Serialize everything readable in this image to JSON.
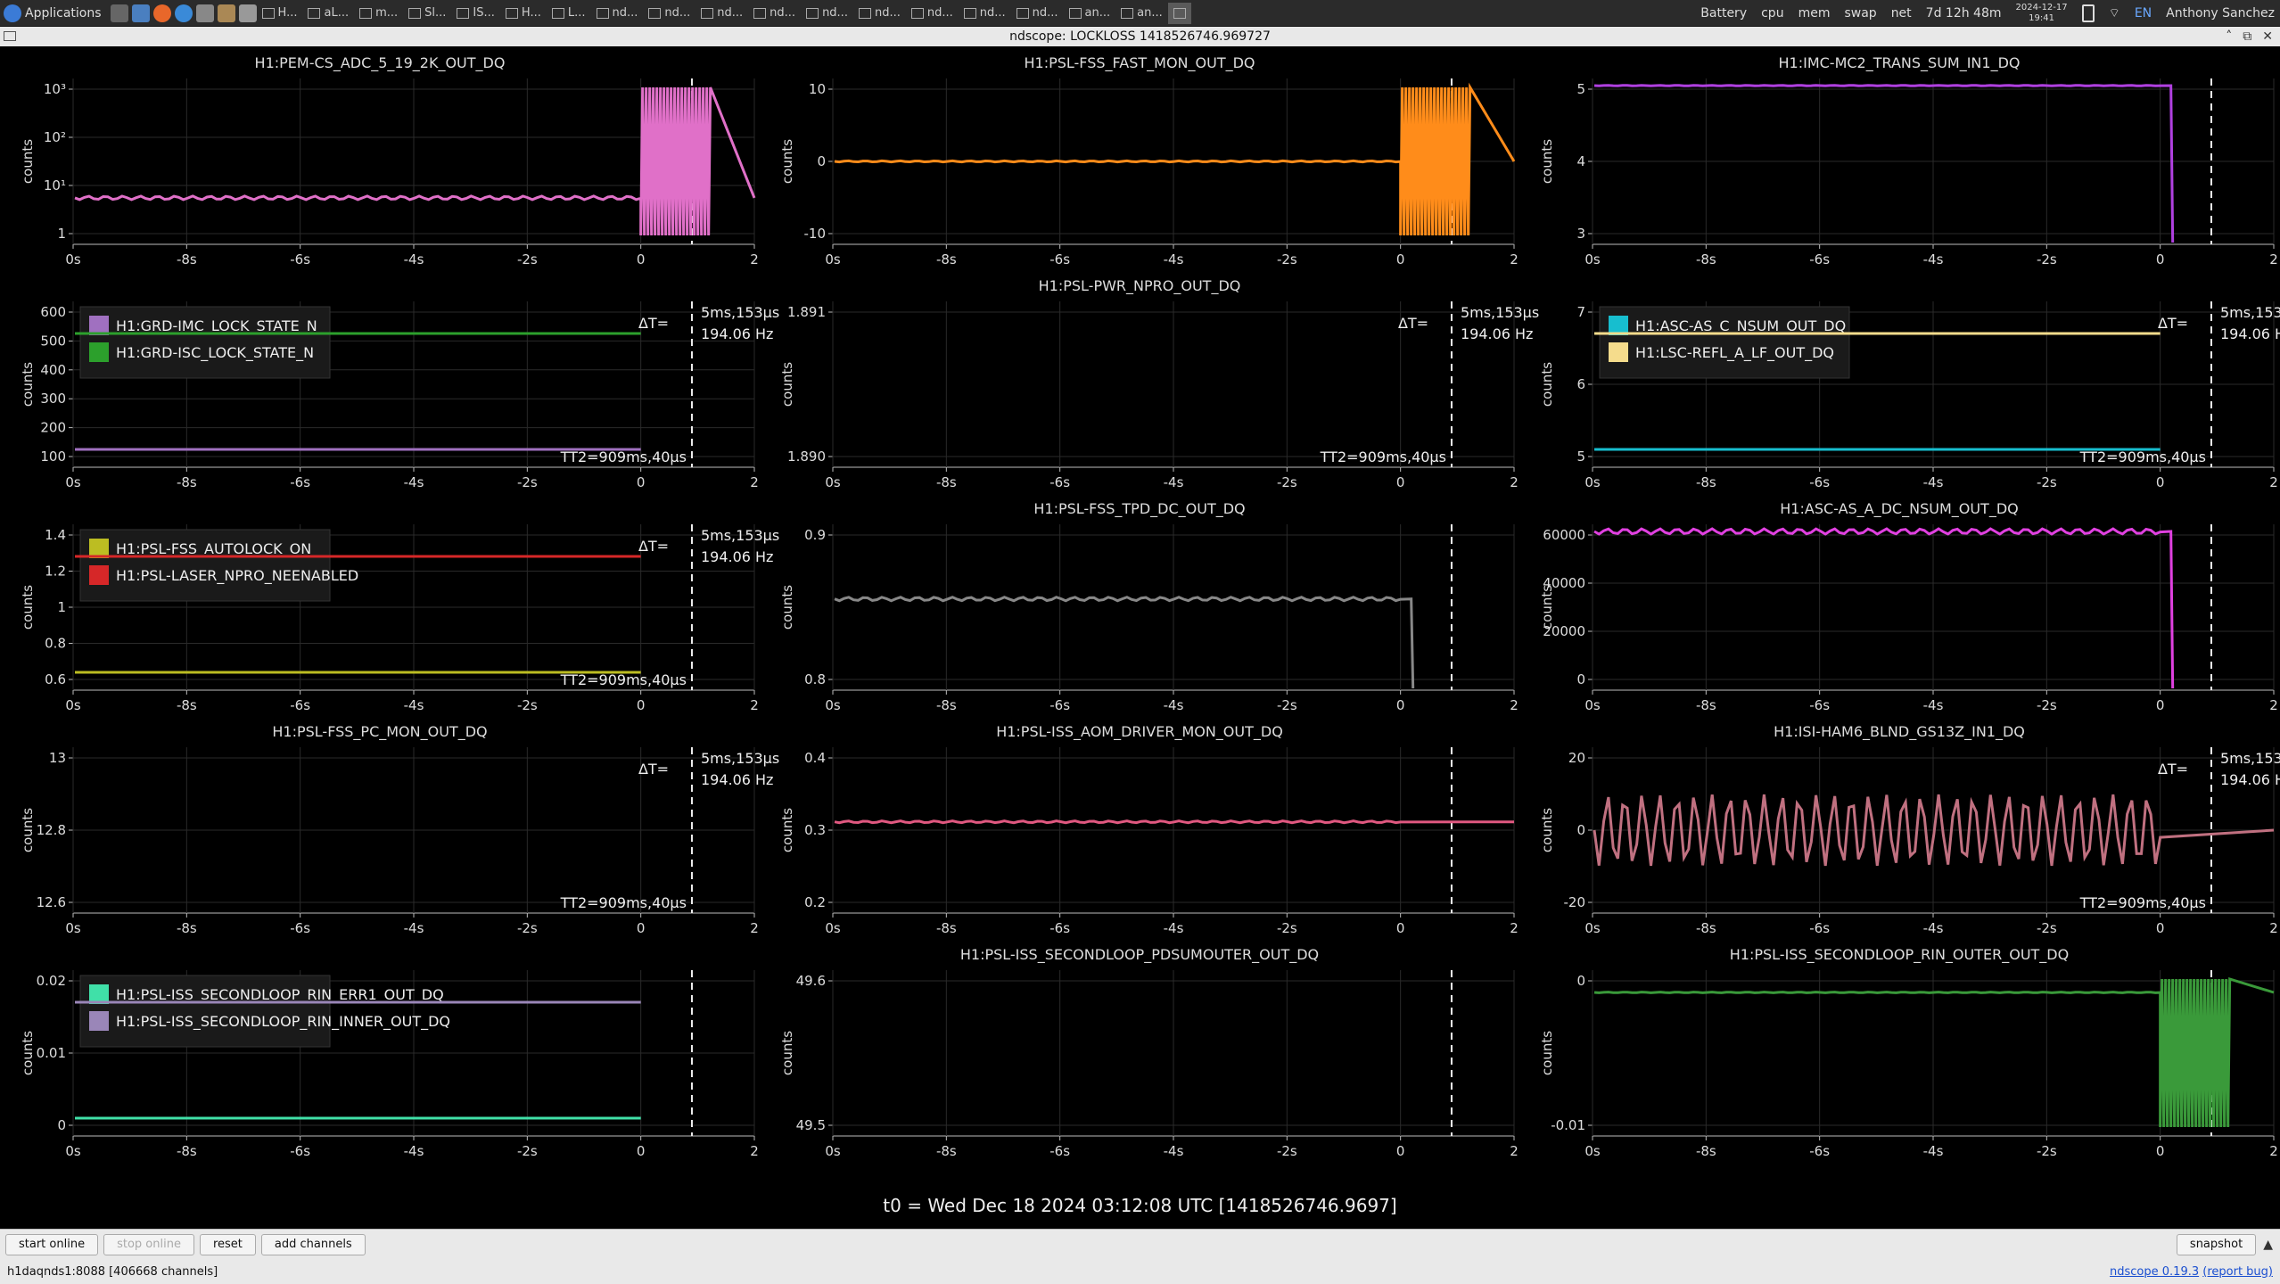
{
  "taskbar": {
    "applications_label": "Applications",
    "tasks": [
      "H...",
      "aL...",
      "m...",
      "Sl...",
      "IS...",
      "H...",
      "L...",
      "nd...",
      "nd...",
      "nd...",
      "nd...",
      "nd...",
      "nd...",
      "nd...",
      "nd...",
      "nd...",
      "an...",
      "an..."
    ],
    "indicators": [
      "Battery",
      "cpu",
      "mem",
      "swap",
      "net"
    ],
    "uptime": "7d 12h 48m",
    "date": "2024-12-17",
    "time": "19:41",
    "lang": "EN",
    "user": "Anthony Sanchez"
  },
  "window": {
    "title": "ndscope: LOCKLOSS 1418526746.969727"
  },
  "plots": [
    {
      "title": "H1:PEM-CS_ADC_5_19_2K_OUT_DQ",
      "ylabel": "counts",
      "yticks": [
        "10³",
        "10²",
        "10¹",
        "1"
      ],
      "legend": [],
      "cursor": false
    },
    {
      "title": "H1:PSL-FSS_FAST_MON_OUT_DQ",
      "ylabel": "counts",
      "yticks": [
        "10",
        "0",
        "-10"
      ],
      "legend": [],
      "cursor": false
    },
    {
      "title": "H1:IMC-MC2_TRANS_SUM_IN1_DQ",
      "ylabel": "counts",
      "yticks": [
        "5",
        "4",
        "3"
      ],
      "legend": [],
      "cursor": false
    },
    {
      "title": "",
      "ylabel": "counts",
      "yticks": [
        "600",
        "500",
        "400",
        "300",
        "200",
        "100"
      ],
      "legend": [
        {
          "name": "H1:GRD-IMC_LOCK_STATE_N",
          "color": "#a070c0"
        },
        {
          "name": "H1:GRD-ISC_LOCK_STATE_N",
          "color": "#2ca02c"
        }
      ],
      "cursor": true
    },
    {
      "title": "H1:PSL-PWR_NPRO_OUT_DQ",
      "ylabel": "counts",
      "yticks": [
        "1.891",
        "1.890"
      ],
      "legend": [],
      "cursor": true
    },
    {
      "title": "",
      "ylabel": "counts",
      "yticks": [
        "7",
        "6",
        "5"
      ],
      "legend": [
        {
          "name": "H1:ASC-AS_C_NSUM_OUT_DQ",
          "color": "#17becf"
        },
        {
          "name": "H1:LSC-REFL_A_LF_OUT_DQ",
          "color": "#f5dc8c"
        }
      ],
      "cursor": true
    },
    {
      "title": "",
      "ylabel": "counts",
      "yticks": [
        "1.4",
        "1.2",
        "1",
        "0.8",
        "0.6"
      ],
      "legend": [
        {
          "name": "H1:PSL-FSS_AUTOLOCK_ON",
          "color": "#bcbd22"
        },
        {
          "name": "H1:PSL-LASER_NPRO_NEENABLED",
          "color": "#d62728"
        }
      ],
      "cursor": true
    },
    {
      "title": "H1:PSL-FSS_TPD_DC_OUT_DQ",
      "ylabel": "counts",
      "yticks": [
        "0.9",
        "0.8"
      ],
      "legend": [],
      "cursor": false
    },
    {
      "title": "H1:ASC-AS_A_DC_NSUM_OUT_DQ",
      "ylabel": "counts",
      "yticks": [
        "60000",
        "40000",
        "20000",
        "0"
      ],
      "legend": [],
      "cursor": false
    },
    {
      "title": "H1:PSL-FSS_PC_MON_OUT_DQ",
      "ylabel": "counts",
      "yticks": [
        "13",
        "12.8",
        "12.6"
      ],
      "legend": [],
      "cursor": true
    },
    {
      "title": "H1:PSL-ISS_AOM_DRIVER_MON_OUT_DQ",
      "ylabel": "counts",
      "yticks": [
        "0.4",
        "0.3",
        "0.2"
      ],
      "legend": [],
      "cursor": false
    },
    {
      "title": "H1:ISI-HAM6_BLND_GS13Z_IN1_DQ",
      "ylabel": "counts",
      "yticks": [
        "20",
        "0",
        "-20"
      ],
      "legend": [],
      "cursor": true
    },
    {
      "title": "",
      "ylabel": "counts",
      "yticks": [
        "0.02",
        "0.01",
        "0"
      ],
      "legend": [
        {
          "name": "H1:PSL-ISS_SECONDLOOP_RIN_ERR1_OUT_DQ",
          "color": "#40e0a8"
        },
        {
          "name": "H1:PSL-ISS_SECONDLOOP_RIN_INNER_OUT_DQ",
          "color": "#9a86b8"
        }
      ],
      "cursor": false
    },
    {
      "title": "H1:PSL-ISS_SECONDLOOP_PDSUMOUTER_OUT_DQ",
      "ylabel": "counts",
      "yticks": [
        "49.6",
        "49.5"
      ],
      "legend": [],
      "cursor": false
    },
    {
      "title": "H1:PSL-ISS_SECONDLOOP_RIN_OUTER_OUT_DQ",
      "ylabel": "counts",
      "yticks": [
        "0",
        "-0.01"
      ],
      "legend": [],
      "cursor": false
    }
  ],
  "xticks": [
    "0s",
    "-8s",
    "-6s",
    "-4s",
    "-2s",
    "0",
    "2"
  ],
  "cursor_readout": {
    "dt_prefix": "ΔT=",
    "dt": "5ms,153μs",
    "freq": "194.06 Hz",
    "t2": "TT2=909ms,40μs"
  },
  "t0_label": "t0 = Wed Dec 18 2024 03:12:08 UTC [1418526746.9697]",
  "bottom": {
    "start_online": "start online",
    "stop_online": "stop online",
    "reset": "reset",
    "add_channels": "add channels",
    "snapshot": "snapshot"
  },
  "status": {
    "server": "h1daqnds1:8088  [406668 channels]",
    "version": "ndscope 0.19.3",
    "report": "(report bug)"
  }
}
